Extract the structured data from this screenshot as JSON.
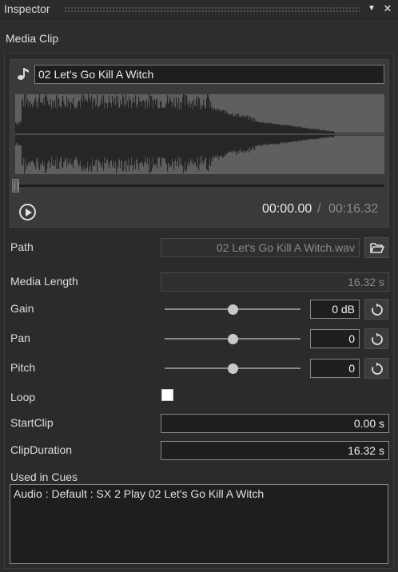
{
  "window": {
    "title": "Inspector",
    "dropdown_glyph": "▼",
    "close_glyph": "✕"
  },
  "section": {
    "title": "Media Clip"
  },
  "media": {
    "clip_name": "02 Let's Go Kill A Witch",
    "current_time": "00:00.00",
    "separator": "/",
    "total_time": "00:16.32",
    "icon": "music-note-icon"
  },
  "properties": {
    "path_label": "Path",
    "path_value": "02 Let's Go Kill A Witch.wav",
    "media_length_label": "Media Length",
    "media_length_value": "16.32 s",
    "gain_label": "Gain",
    "gain_value": "0 dB",
    "gain_slider_level": 0.5,
    "pan_label": "Pan",
    "pan_value": "0",
    "pan_slider_level": 0.5,
    "pitch_label": "Pitch",
    "pitch_value": "0",
    "pitch_slider_level": 0.5,
    "loop_label": "Loop",
    "loop_checked": false,
    "start_clip_label": "StartClip",
    "start_clip_value": "0.00 s",
    "clip_duration_label": "ClipDuration",
    "clip_duration_value": "16.32 s"
  },
  "cues": {
    "label": "Used in Cues",
    "items": [
      "Audio : Default : SX 2 Play 02 Let's Go Kill A Witch"
    ]
  },
  "colors": {
    "background": "#2d2d2d",
    "field": "#1e1e1e",
    "waveform_bg": "#5f5f5f",
    "waveform": "#262626"
  }
}
